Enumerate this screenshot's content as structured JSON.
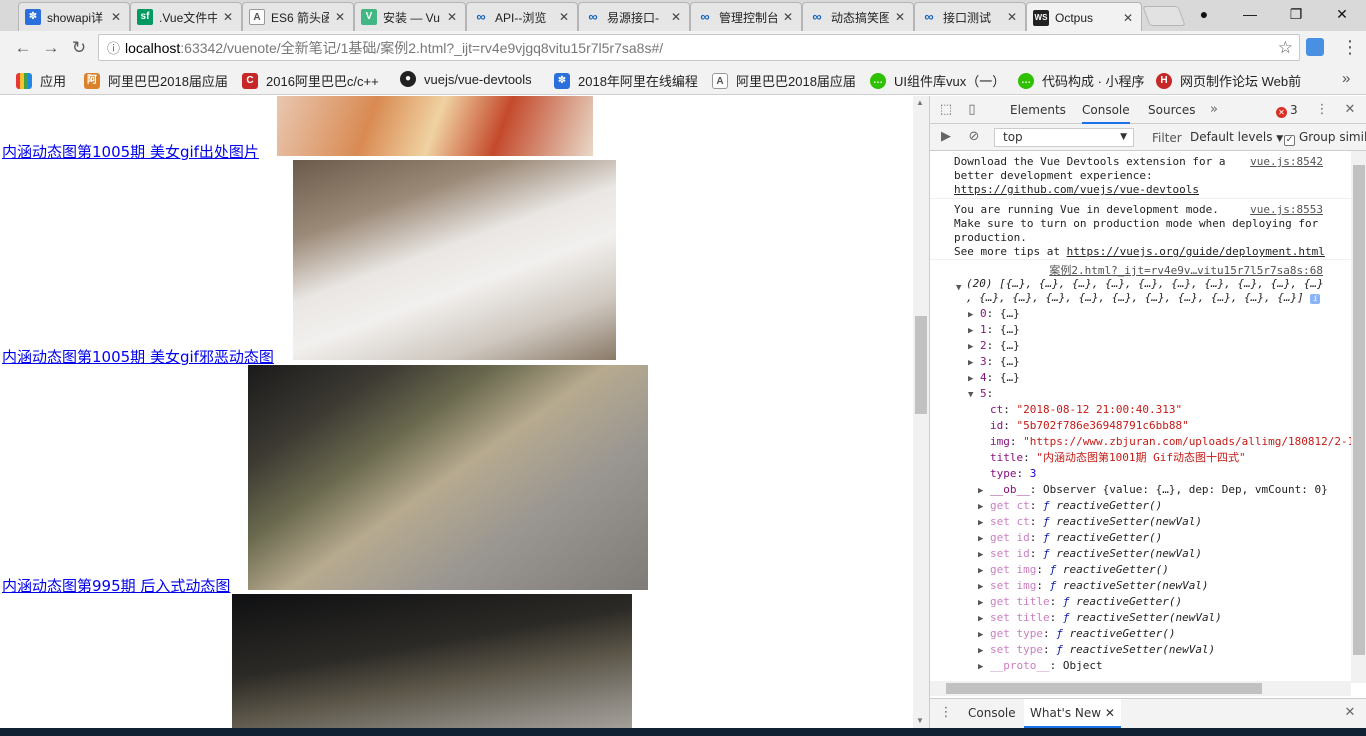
{
  "tabs": [
    {
      "title": "showapi详",
      "icon": "paw-icon",
      "color": "#2a6fdb"
    },
    {
      "title": ".Vue文件中",
      "icon": "sf-icon",
      "color": "#009a61"
    },
    {
      "title": "ES6 箭头函",
      "icon": "a-icon",
      "color": "#555555"
    },
    {
      "title": "安装 — Vu",
      "icon": "vue-icon",
      "color": "#41b883"
    },
    {
      "title": "API--浏览",
      "icon": "link-icon",
      "color": "#1565c0"
    },
    {
      "title": "易源接口-",
      "icon": "link-icon",
      "color": "#1565c0"
    },
    {
      "title": "管理控制台",
      "icon": "link-icon",
      "color": "#1565c0"
    },
    {
      "title": "动态搞笑图",
      "icon": "link-icon",
      "color": "#1565c0"
    },
    {
      "title": "接口测试",
      "icon": "link-icon",
      "color": "#1565c0"
    },
    {
      "title": "Octpus",
      "icon": "ws-icon",
      "color": "#222222"
    }
  ],
  "address": {
    "host": "localhost",
    "path": ":63342/vuenote/全新笔记/1基础/案例2.html?_ijt=rv4e9vjgq8vitu15r7l5r7sa8s#/"
  },
  "bookmarks": [
    {
      "label": "应用",
      "icon": "apps-icon",
      "color": "#e8710a"
    },
    {
      "label": "阿里巴巴2018届应届",
      "icon": "ali-icon",
      "color": "#d9822b"
    },
    {
      "label": "2016阿里巴巴c/c++",
      "icon": "c-icon",
      "color": "#c62828"
    },
    {
      "label": "vuejs/vue-devtools",
      "icon": "github-icon",
      "color": "#222222"
    },
    {
      "label": "2018年阿里在线编程",
      "icon": "paw-icon",
      "color": "#2a6fdb"
    },
    {
      "label": "阿里巴巴2018届应届",
      "icon": "a-icon",
      "color": "#555555"
    },
    {
      "label": "UI组件库vux（一）",
      "icon": "wechat-icon",
      "color": "#2dc100"
    },
    {
      "label": "代码构成 · 小程序",
      "icon": "wechat-icon",
      "color": "#2dc100"
    },
    {
      "label": "网页制作论坛 Web前",
      "icon": "h-icon",
      "color": "#c62828"
    }
  ],
  "page": {
    "links": [
      "内涵动态图第1005期 美女gif出处图片",
      "内涵动态图第1005期 美女gif邪恶动态图",
      "内涵动态图第995期 后入式动态图"
    ]
  },
  "devtools": {
    "tabs": [
      "Elements",
      "Console",
      "Sources"
    ],
    "error_count": "3",
    "context": "top",
    "filter_placeholder": "Filter",
    "levels": "Default levels",
    "group_label": "Group simila",
    "drawer_tabs": [
      "Console",
      "What's New"
    ],
    "messages": {
      "m1_text1": "Download the Vue Devtools extension for a",
      "m1_text2": "better development experience:",
      "m1_link": "https://github.com/vuejs/vue-devtools",
      "m1_src": "vue.js:8542",
      "m2_text1": "You are running Vue in development mode.",
      "m2_text2": "Make sure to turn on production mode when deploying for",
      "m2_text3": "production.",
      "m2_text4": "See more tips at ",
      "m2_link": "https://vuejs.org/guide/deployment.html",
      "m2_src": "vue.js:8553",
      "m3_src": "案例2.html?_ijt=rv4e9v…vitu15r7l5r7sa8s:68",
      "arr_line1": "(20) [{…}, {…}, {…}, {…}, {…}, {…}, {…}, {…}, {…}, {…}",
      "arr_line2": ", {…}, {…}, {…}, {…}, {…}, {…}, {…}, {…}, {…}, {…}]"
    },
    "collapsed_items": [
      "0: {…}",
      "1: {…}",
      "2: {…}",
      "3: {…}",
      "4: {…}"
    ],
    "expanded_key": "5:",
    "props": [
      {
        "key": "ct",
        "value": "\"2018-08-12 21:00:40.313\""
      },
      {
        "key": "id",
        "value": "\"5b702f786e36948791c6bb88\""
      },
      {
        "key": "img",
        "value": "\"https://www.zbjuran.com/uploads/allimg/180812/2-1"
      },
      {
        "key": "title",
        "value": "\"内涵动态图第1001期 Gif动态图十四式\""
      },
      {
        "key": "type",
        "value": "3"
      }
    ],
    "observer": {
      "key": "__ob__",
      "value": "Observer {value: {…}, dep: Dep, vmCount: 0}"
    },
    "accessors": [
      {
        "kw": "get",
        "key": "ct",
        "fn": "reactiveGetter()"
      },
      {
        "kw": "set",
        "key": "ct",
        "fn": "reactiveSetter(newVal)"
      },
      {
        "kw": "get",
        "key": "id",
        "fn": "reactiveGetter()"
      },
      {
        "kw": "set",
        "key": "id",
        "fn": "reactiveSetter(newVal)"
      },
      {
        "kw": "get",
        "key": "img",
        "fn": "reactiveGetter()"
      },
      {
        "kw": "set",
        "key": "img",
        "fn": "reactiveSetter(newVal)"
      },
      {
        "kw": "get",
        "key": "title",
        "fn": "reactiveGetter()"
      },
      {
        "kw": "set",
        "key": "title",
        "fn": "reactiveSetter(newVal)"
      },
      {
        "kw": "get",
        "key": "type",
        "fn": "reactiveGetter()"
      },
      {
        "kw": "set",
        "key": "type",
        "fn": "reactiveSetter(newVal)"
      }
    ],
    "proto": {
      "key": "__proto__",
      "value": "Object"
    }
  }
}
